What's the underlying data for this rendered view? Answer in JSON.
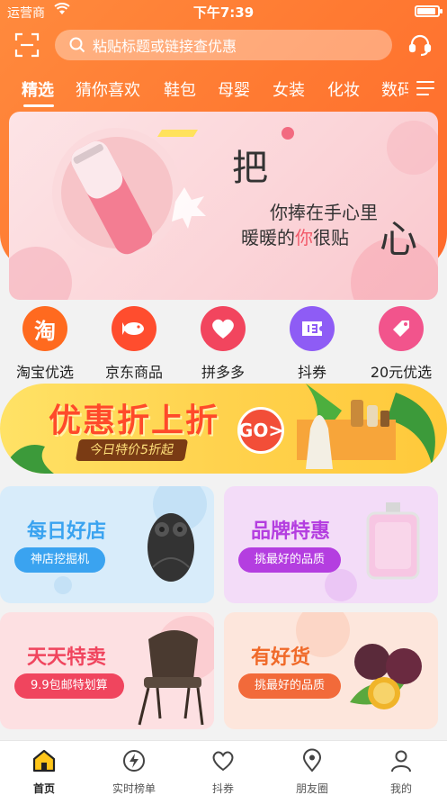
{
  "status_bar": {
    "carrier": "运营商",
    "time": "下午7:39"
  },
  "search": {
    "placeholder": "粘贴标题或链接查优惠"
  },
  "tabs": [
    {
      "label": "精选",
      "active": true
    },
    {
      "label": "猜你喜欢"
    },
    {
      "label": "鞋包"
    },
    {
      "label": "母婴"
    },
    {
      "label": "女装"
    },
    {
      "label": "化妆"
    },
    {
      "label": "数码"
    }
  ],
  "banner": {
    "line_big_1": "把",
    "line_1": "你捧在手心里",
    "line_2_pre": "暖暖的",
    "line_2_hi": "你",
    "line_2_post": "很贴",
    "line_big_2": "心"
  },
  "categories": [
    {
      "label": "淘宝优选",
      "icon": "taobao-icon",
      "glyph": "淘",
      "color": "#ff6a1f"
    },
    {
      "label": "京东商品",
      "icon": "jd-dog-icon",
      "glyph": "🐟",
      "color": "#ff4d2e"
    },
    {
      "label": "拼多多",
      "icon": "pinduoduo-heart-icon",
      "glyph": "♥",
      "color": "#f2455e"
    },
    {
      "label": "抖券",
      "icon": "ticket-icon",
      "glyph": "券",
      "color": "#8e5cf5"
    },
    {
      "label": "20元优选",
      "icon": "tag-icon",
      "glyph": "✎",
      "color": "#f2548c"
    }
  ],
  "promo": {
    "title": "优惠折上折",
    "subtitle": "今日特价5折起",
    "go": "GO>"
  },
  "cards": [
    {
      "title": "每日好店",
      "pill": "神店挖掘机",
      "title_color": "#3aa3f0",
      "pill_color": "#3aa3f0",
      "bg": "#d8ecfa"
    },
    {
      "title": "品牌特惠",
      "pill": "挑最好的品质",
      "title_color": "#b43ee0",
      "pill_color": "#b43ee0",
      "bg": "#f3dcf8"
    },
    {
      "title": "天天特卖",
      "pill": "9.9包邮特划算",
      "title_color": "#f0455e",
      "pill_color": "#f0455e",
      "bg": "#fde0e2"
    },
    {
      "title": "有好货",
      "pill": "挑最好的品质",
      "title_color": "#f06a2a",
      "pill_color": "#f26a3a",
      "bg": "#fde6dc"
    }
  ],
  "bottom_nav": [
    {
      "label": "首页",
      "icon": "home-icon",
      "active": true
    },
    {
      "label": "实时榜单",
      "icon": "lightning-icon"
    },
    {
      "label": "抖券",
      "icon": "heart-icon"
    },
    {
      "label": "朋友圈",
      "icon": "location-icon"
    },
    {
      "label": "我的",
      "icon": "user-icon"
    }
  ]
}
